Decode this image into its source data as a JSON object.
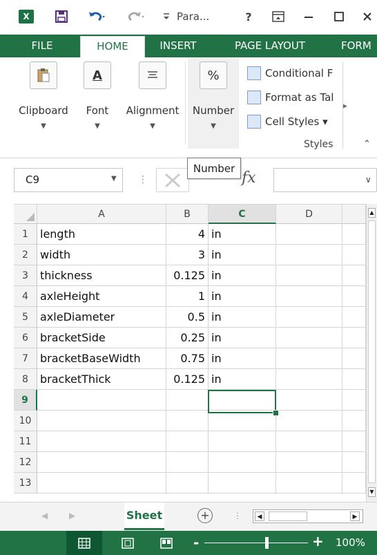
{
  "window": {
    "title": "Para...",
    "help_label": "?",
    "icons": [
      "excel-logo-icon",
      "save-icon",
      "undo-icon",
      "redo-icon",
      "customize-qat-icon",
      "ribbon-display-icon",
      "minimize-icon",
      "maximize-icon",
      "close-icon"
    ]
  },
  "ribbon_tabs": [
    "FILE",
    "HOME",
    "INSERT",
    "PAGE LAYOUT",
    "FORM"
  ],
  "ribbon": {
    "clipboard": "Clipboard",
    "font": "Font",
    "alignment": "Alignment",
    "number": "Number",
    "number_symbol": "%",
    "font_symbol": "A",
    "styles_items": [
      "Conditional F",
      "Format as Tal",
      "Cell Styles ▾"
    ],
    "styles_group": "Styles"
  },
  "formula_bar": {
    "name_box": "C9",
    "tooltip": "Number",
    "fx": "fx",
    "formula_value": ""
  },
  "sheet": {
    "columns": [
      "A",
      "B",
      "C",
      "D"
    ],
    "selected_column": "C",
    "rows": [
      {
        "n": "1",
        "a": "length",
        "b": "4",
        "c": "in"
      },
      {
        "n": "2",
        "a": "width",
        "b": "3",
        "c": "in"
      },
      {
        "n": "3",
        "a": "thickness",
        "b": "0.125",
        "c": "in"
      },
      {
        "n": "4",
        "a": "axleHeight",
        "b": "1",
        "c": "in"
      },
      {
        "n": "5",
        "a": "axleDiameter",
        "b": "0.5",
        "c": "in"
      },
      {
        "n": "6",
        "a": "bracketSide",
        "b": "0.25",
        "c": "in"
      },
      {
        "n": "7",
        "a": "bracketBaseWidth",
        "b": "0.75",
        "c": "in"
      },
      {
        "n": "8",
        "a": "bracketThick",
        "b": "0.125",
        "c": "in"
      },
      {
        "n": "9",
        "a": "",
        "b": "",
        "c": ""
      },
      {
        "n": "10",
        "a": "",
        "b": "",
        "c": ""
      },
      {
        "n": "11",
        "a": "",
        "b": "",
        "c": ""
      },
      {
        "n": "12",
        "a": "",
        "b": "",
        "c": ""
      },
      {
        "n": "13",
        "a": "",
        "b": "",
        "c": ""
      }
    ],
    "active_cell": "C9",
    "selected_row": "9"
  },
  "sheet_tabs": {
    "active": "Sheet",
    "add_label": "+"
  },
  "status_bar": {
    "zoom": "100%",
    "zoom_minus": "-",
    "zoom_plus": "+",
    "zoom_level": 0.6
  },
  "colors": {
    "accent": "#217346"
  }
}
